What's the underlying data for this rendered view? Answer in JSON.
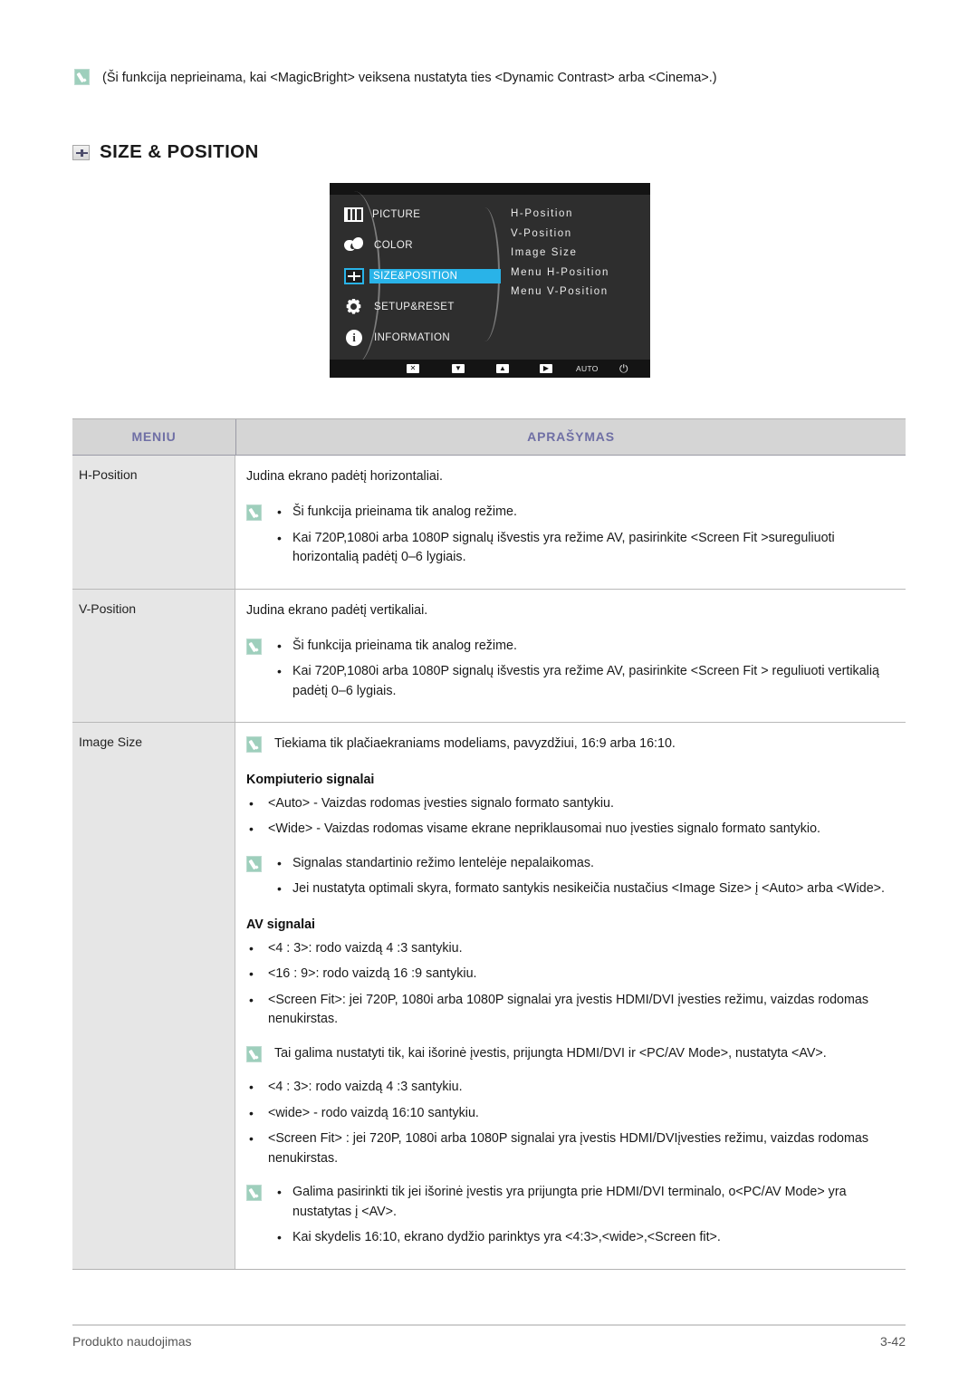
{
  "top_note": {
    "icon": "note-icon",
    "text": "(Ši funkcija neprieinama, kai <MagicBright> veiksena nustatyta ties <Dynamic Contrast> arba <Cinema>.)"
  },
  "section": {
    "icon": "size-position-icon",
    "title": "SIZE & POSITION"
  },
  "osd": {
    "left_menu": [
      {
        "icon": "picture-icon",
        "label": "PICTURE",
        "selected": false
      },
      {
        "icon": "color-icon",
        "label": "COLOR",
        "selected": false
      },
      {
        "icon": "size-position-icon",
        "label": "SIZE&POSITION",
        "selected": true
      },
      {
        "icon": "gear-icon",
        "label": "SETUP&RESET",
        "selected": false
      },
      {
        "icon": "information-icon",
        "label": "INFORMATION",
        "selected": false
      }
    ],
    "submenu": [
      "H-Position",
      "V-Position",
      "Image Size",
      "Menu H-Position",
      "Menu V-Position"
    ],
    "buttons": {
      "exit": "✕",
      "down": "▼",
      "up": "▲",
      "enter": "▶",
      "auto": "AUTO",
      "power": "⏻"
    },
    "highlight_color": "#29b3e8"
  },
  "table": {
    "headers": {
      "menu": "MENIU",
      "description": "APRAŠYMAS"
    },
    "header_text_color": "#6f6fa5",
    "rows": [
      {
        "menu": "H-Position",
        "intro": "Judina ekrano padėtį horizontaliai.",
        "bullets": [
          {
            "note": true,
            "text": "Ši funkcija prieinama tik analog režime."
          },
          {
            "note": false,
            "text": "Kai 720P,1080i arba 1080P signalų išvestis yra režime AV, pasirinkite <Screen Fit >sureguliuoti horizontalią padėtį 0–6 lygiais."
          }
        ]
      },
      {
        "menu": "V-Position",
        "intro": "Judina ekrano padėtį vertikaliai.",
        "bullets": [
          {
            "note": true,
            "text": "Ši funkcija prieinama tik analog režime."
          },
          {
            "note": false,
            "text": "Kai 720P,1080i arba 1080P signalų išvestis yra režime AV, pasirinkite <Screen Fit  > reguliuoti vertikalią padėtį 0–6 lygiais."
          }
        ]
      },
      {
        "menu": "Image Size",
        "note_line": "Tiekiama tik plačiaekraniams modeliams, pavyzdžiui, 16:9 arba 16:10.",
        "pc_heading": "Kompiuterio signalai",
        "pc_bullets": [
          "<Auto> - Vaizdas rodomas įvesties signalo formato santykiu.",
          "<Wide> - Vaizdas rodomas visame ekrane nepriklausomai nuo įvesties signalo formato santykio."
        ],
        "pc_notes": [
          {
            "note": true,
            "text": "Signalas standartinio režimo lentelėje nepalaikomas."
          },
          {
            "note": false,
            "text": "Jei nustatyta optimali skyra, formato santykis nesikeičia nustačius <Image Size> į <Auto> arba <Wide>."
          }
        ],
        "av_heading": "AV signalai",
        "av_bullets_1": [
          "<4 : 3>: rodo vaizdą 4 :3 santykiu.",
          "<16 : 9>: rodo vaizdą 16 :9 santykiu.",
          "<Screen Fit>: jei 720P, 1080i arba 1080P signalai yra įvestis HDMI/DVI įvesties režimu, vaizdas rodomas nenukirstas."
        ],
        "av_note_1": "Tai galima nustatyti tik, kai išorinė įvestis, prijungta HDMI/DVI ir <PC/AV Mode>, nustatyta <AV>.",
        "av_bullets_2": [
          "<4 : 3>: rodo vaizdą 4 :3 santykiu.",
          "<wide> - rodo vaizdą 16:10 santykiu.",
          "<Screen Fit> : jei 720P, 1080i arba 1080P signalai yra įvestis HDMI/DVIįvesties režimu, vaizdas rodomas nenukirstas."
        ],
        "av_notes_2": [
          {
            "note": true,
            "text": "Galima pasirinkti tik jei išorinė įvestis yra prijungta prie HDMI/DVI terminalo, o<PC/AV Mode> yra nustatytas į <AV>."
          },
          {
            "note": false,
            "text": "Kai skydelis 16:10, ekrano dydžio parinktys yra <4:3>,<wide>,<Screen fit>."
          }
        ]
      }
    ]
  },
  "footer": {
    "left": "Produkto naudojimas",
    "right": "3-42"
  }
}
